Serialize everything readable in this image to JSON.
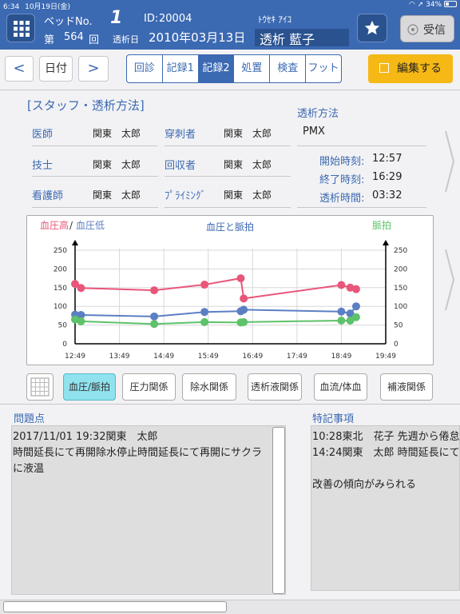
{
  "status_bar": {
    "time": "6:34",
    "date": "10月19日(金)",
    "battery": "34%"
  },
  "header": {
    "bed_label": "ベッドNo.",
    "bed_number": "1",
    "id_label": "ID:",
    "id_value": "20004",
    "kana": "ﾄｳｾｷ ｱｲｺ",
    "session_prefix": "第",
    "session_number": "564",
    "session_suffix": "回",
    "date_label": "透析日",
    "date_value": "2010年03月13日",
    "patient_name": "透析 藍子",
    "receive_label": "受信"
  },
  "toolbar": {
    "prev": "<",
    "date_btn": "日付",
    "next": ">",
    "tabs": [
      {
        "label": "回診",
        "active": false
      },
      {
        "label": "記録1",
        "active": false
      },
      {
        "label": "記録2",
        "active": true
      },
      {
        "label": "処置",
        "active": false
      },
      {
        "label": "検査",
        "active": false
      },
      {
        "label": "フット",
        "active": false
      }
    ],
    "edit": "編集する"
  },
  "staff": {
    "title": "[スタッフ・透析方法]",
    "rows": [
      {
        "role1": "医師",
        "name1": "関東　太郎",
        "role2": "穿刺者",
        "name2": "関東　太郎"
      },
      {
        "role1": "技士",
        "name1": "関東　太郎",
        "role2": "回収者",
        "name2": "関東　太郎"
      },
      {
        "role1": "看護師",
        "name1": "関東　太郎",
        "role2": "ﾌﾟﾗｲﾐﾝｸﾞ",
        "name2": "関東　太郎"
      }
    ],
    "method_title": "透析方法",
    "method_value": "PMX",
    "times": [
      {
        "label": "開始時刻:",
        "value": "12:57"
      },
      {
        "label": "終了時刻:",
        "value": "16:29"
      },
      {
        "label": "透析時間:",
        "value": "03:32"
      }
    ]
  },
  "chart_data": {
    "type": "line",
    "title": "血圧と脈拍",
    "left_label_high": "血圧高",
    "left_label_sep": "/",
    "left_label_low": "血圧低",
    "right_label": "脈拍",
    "x_ticks": [
      "12:49",
      "13:49",
      "14:49",
      "15:49",
      "16:49",
      "17:49",
      "18:49",
      "19:49"
    ],
    "x_range": [
      "12:49",
      "19:49"
    ],
    "y_ticks": [
      0,
      50,
      100,
      150,
      200,
      250
    ],
    "ylim": [
      0,
      250
    ],
    "y2_ticks": [
      0,
      50,
      100,
      150,
      200,
      250
    ],
    "y2lim": [
      0,
      250
    ],
    "grid": true,
    "colors": {
      "high": "#e8567a",
      "low": "#5b7fc4",
      "pulse": "#5ec26a",
      "title": "#3b69b2"
    },
    "series": [
      {
        "name": "血圧高",
        "axis": "left",
        "x": [
          "12:49",
          "12:57",
          "14:36",
          "15:44",
          "16:33",
          "16:37",
          "18:49",
          "19:01",
          "19:09"
        ],
        "values": [
          160,
          149,
          143,
          158,
          175,
          121,
          157,
          150,
          146
        ]
      },
      {
        "name": "血圧低",
        "axis": "left",
        "x": [
          "12:49",
          "12:57",
          "14:36",
          "15:44",
          "16:33",
          "16:37",
          "18:49",
          "19:01",
          "19:09"
        ],
        "values": [
          78,
          77,
          73,
          85,
          87,
          91,
          86,
          81,
          100
        ]
      },
      {
        "name": "脈拍",
        "axis": "right",
        "x": [
          "12:49",
          "12:57",
          "14:36",
          "15:44",
          "16:33",
          "16:37",
          "18:49",
          "19:01",
          "19:09"
        ],
        "values": [
          65,
          60,
          53,
          58,
          57,
          58,
          62,
          62,
          71
        ]
      }
    ]
  },
  "chart_buttons": [
    {
      "label": "血圧/脈拍",
      "active": true
    },
    {
      "label": "圧力関係",
      "active": false
    },
    {
      "label": "除水関係",
      "active": false
    },
    {
      "label": "透析液関係",
      "active": false
    },
    {
      "label": "血流/体血",
      "active": false
    },
    {
      "label": "補液関係",
      "active": false
    }
  ],
  "problems": {
    "title": "問題点",
    "lines": [
      "2017/11/01 19:32関東　太郎",
      "時間延長にて再開除水停止時間延長にて再開にサクラ",
      "に液温"
    ]
  },
  "notes": {
    "title": "特記事項",
    "lines": [
      "10:28東北　花子 先週から倦怠",
      "14:24関東　太郎 時間延長にて",
      "",
      "改善の傾向がみられる"
    ]
  }
}
